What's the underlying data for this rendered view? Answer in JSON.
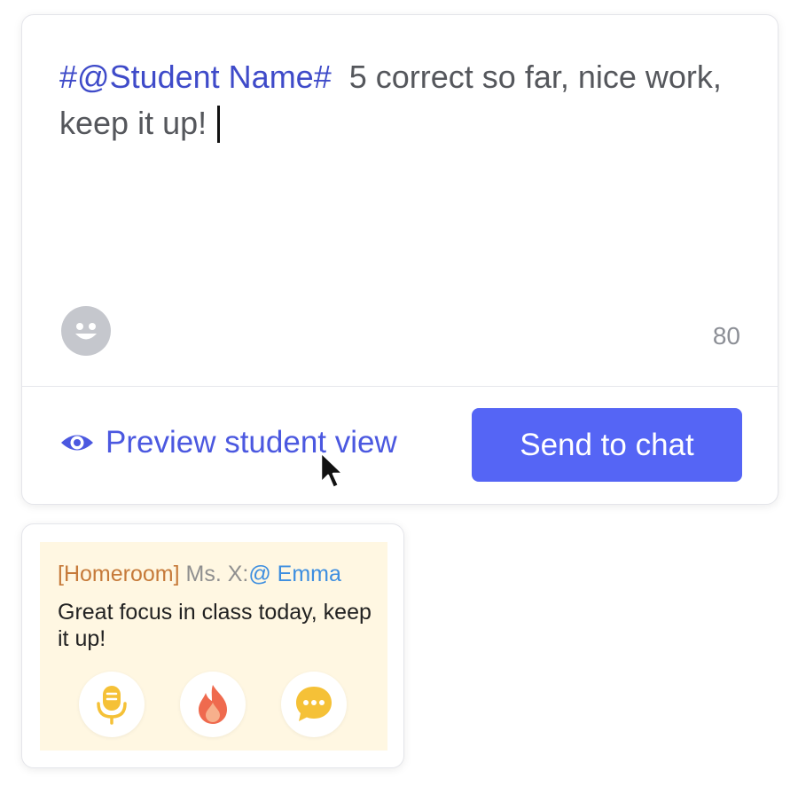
{
  "composer": {
    "placeholder_token": "#@Student Name#",
    "message_text": "5 correct so far, nice work, keep it up!",
    "char_count": "80",
    "preview_label": "Preview student view",
    "send_label": "Send to chat"
  },
  "preview": {
    "tag": "[Homeroom]",
    "sender": "Ms. X:",
    "mention": "@ Emma",
    "message": "Great focus in class today, keep it up!",
    "reactions": [
      "microphone-icon",
      "fire-icon",
      "chat-bubble-icon"
    ]
  },
  "colors": {
    "accent": "#5565f5",
    "token": "#3f4bc9",
    "link": "#4b58e0",
    "bubble_bg": "#fff7e2",
    "tag": "#c67a3a",
    "mention": "#3d8ee0"
  }
}
